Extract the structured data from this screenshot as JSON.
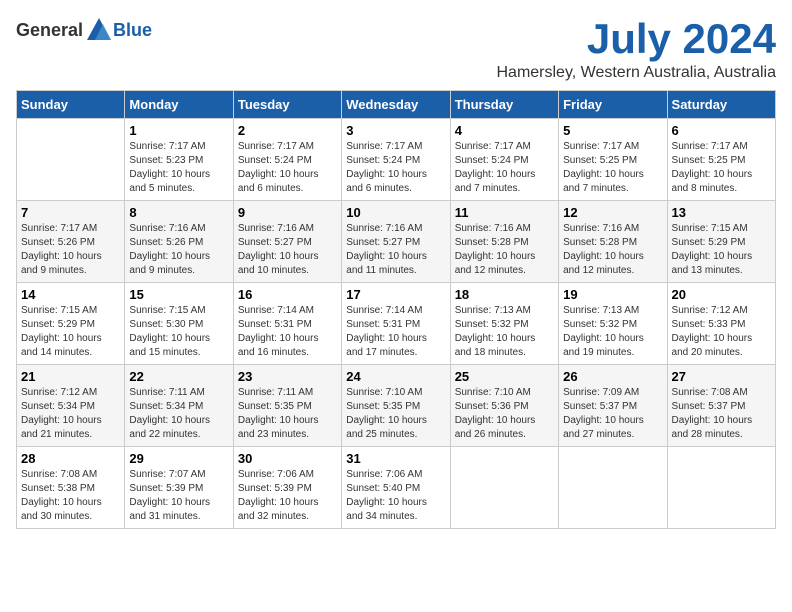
{
  "logo": {
    "general": "General",
    "blue": "Blue"
  },
  "header": {
    "month": "July 2024",
    "location": "Hamersley, Western Australia, Australia"
  },
  "weekdays": [
    "Sunday",
    "Monday",
    "Tuesday",
    "Wednesday",
    "Thursday",
    "Friday",
    "Saturday"
  ],
  "weeks": [
    [
      {
        "day": "",
        "info": ""
      },
      {
        "day": "1",
        "info": "Sunrise: 7:17 AM\nSunset: 5:23 PM\nDaylight: 10 hours\nand 5 minutes."
      },
      {
        "day": "2",
        "info": "Sunrise: 7:17 AM\nSunset: 5:24 PM\nDaylight: 10 hours\nand 6 minutes."
      },
      {
        "day": "3",
        "info": "Sunrise: 7:17 AM\nSunset: 5:24 PM\nDaylight: 10 hours\nand 6 minutes."
      },
      {
        "day": "4",
        "info": "Sunrise: 7:17 AM\nSunset: 5:24 PM\nDaylight: 10 hours\nand 7 minutes."
      },
      {
        "day": "5",
        "info": "Sunrise: 7:17 AM\nSunset: 5:25 PM\nDaylight: 10 hours\nand 7 minutes."
      },
      {
        "day": "6",
        "info": "Sunrise: 7:17 AM\nSunset: 5:25 PM\nDaylight: 10 hours\nand 8 minutes."
      }
    ],
    [
      {
        "day": "7",
        "info": "Sunrise: 7:17 AM\nSunset: 5:26 PM\nDaylight: 10 hours\nand 9 minutes."
      },
      {
        "day": "8",
        "info": "Sunrise: 7:16 AM\nSunset: 5:26 PM\nDaylight: 10 hours\nand 9 minutes."
      },
      {
        "day": "9",
        "info": "Sunrise: 7:16 AM\nSunset: 5:27 PM\nDaylight: 10 hours\nand 10 minutes."
      },
      {
        "day": "10",
        "info": "Sunrise: 7:16 AM\nSunset: 5:27 PM\nDaylight: 10 hours\nand 11 minutes."
      },
      {
        "day": "11",
        "info": "Sunrise: 7:16 AM\nSunset: 5:28 PM\nDaylight: 10 hours\nand 12 minutes."
      },
      {
        "day": "12",
        "info": "Sunrise: 7:16 AM\nSunset: 5:28 PM\nDaylight: 10 hours\nand 12 minutes."
      },
      {
        "day": "13",
        "info": "Sunrise: 7:15 AM\nSunset: 5:29 PM\nDaylight: 10 hours\nand 13 minutes."
      }
    ],
    [
      {
        "day": "14",
        "info": "Sunrise: 7:15 AM\nSunset: 5:29 PM\nDaylight: 10 hours\nand 14 minutes."
      },
      {
        "day": "15",
        "info": "Sunrise: 7:15 AM\nSunset: 5:30 PM\nDaylight: 10 hours\nand 15 minutes."
      },
      {
        "day": "16",
        "info": "Sunrise: 7:14 AM\nSunset: 5:31 PM\nDaylight: 10 hours\nand 16 minutes."
      },
      {
        "day": "17",
        "info": "Sunrise: 7:14 AM\nSunset: 5:31 PM\nDaylight: 10 hours\nand 17 minutes."
      },
      {
        "day": "18",
        "info": "Sunrise: 7:13 AM\nSunset: 5:32 PM\nDaylight: 10 hours\nand 18 minutes."
      },
      {
        "day": "19",
        "info": "Sunrise: 7:13 AM\nSunset: 5:32 PM\nDaylight: 10 hours\nand 19 minutes."
      },
      {
        "day": "20",
        "info": "Sunrise: 7:12 AM\nSunset: 5:33 PM\nDaylight: 10 hours\nand 20 minutes."
      }
    ],
    [
      {
        "day": "21",
        "info": "Sunrise: 7:12 AM\nSunset: 5:34 PM\nDaylight: 10 hours\nand 21 minutes."
      },
      {
        "day": "22",
        "info": "Sunrise: 7:11 AM\nSunset: 5:34 PM\nDaylight: 10 hours\nand 22 minutes."
      },
      {
        "day": "23",
        "info": "Sunrise: 7:11 AM\nSunset: 5:35 PM\nDaylight: 10 hours\nand 23 minutes."
      },
      {
        "day": "24",
        "info": "Sunrise: 7:10 AM\nSunset: 5:35 PM\nDaylight: 10 hours\nand 25 minutes."
      },
      {
        "day": "25",
        "info": "Sunrise: 7:10 AM\nSunset: 5:36 PM\nDaylight: 10 hours\nand 26 minutes."
      },
      {
        "day": "26",
        "info": "Sunrise: 7:09 AM\nSunset: 5:37 PM\nDaylight: 10 hours\nand 27 minutes."
      },
      {
        "day": "27",
        "info": "Sunrise: 7:08 AM\nSunset: 5:37 PM\nDaylight: 10 hours\nand 28 minutes."
      }
    ],
    [
      {
        "day": "28",
        "info": "Sunrise: 7:08 AM\nSunset: 5:38 PM\nDaylight: 10 hours\nand 30 minutes."
      },
      {
        "day": "29",
        "info": "Sunrise: 7:07 AM\nSunset: 5:39 PM\nDaylight: 10 hours\nand 31 minutes."
      },
      {
        "day": "30",
        "info": "Sunrise: 7:06 AM\nSunset: 5:39 PM\nDaylight: 10 hours\nand 32 minutes."
      },
      {
        "day": "31",
        "info": "Sunrise: 7:06 AM\nSunset: 5:40 PM\nDaylight: 10 hours\nand 34 minutes."
      },
      {
        "day": "",
        "info": ""
      },
      {
        "day": "",
        "info": ""
      },
      {
        "day": "",
        "info": ""
      }
    ]
  ]
}
